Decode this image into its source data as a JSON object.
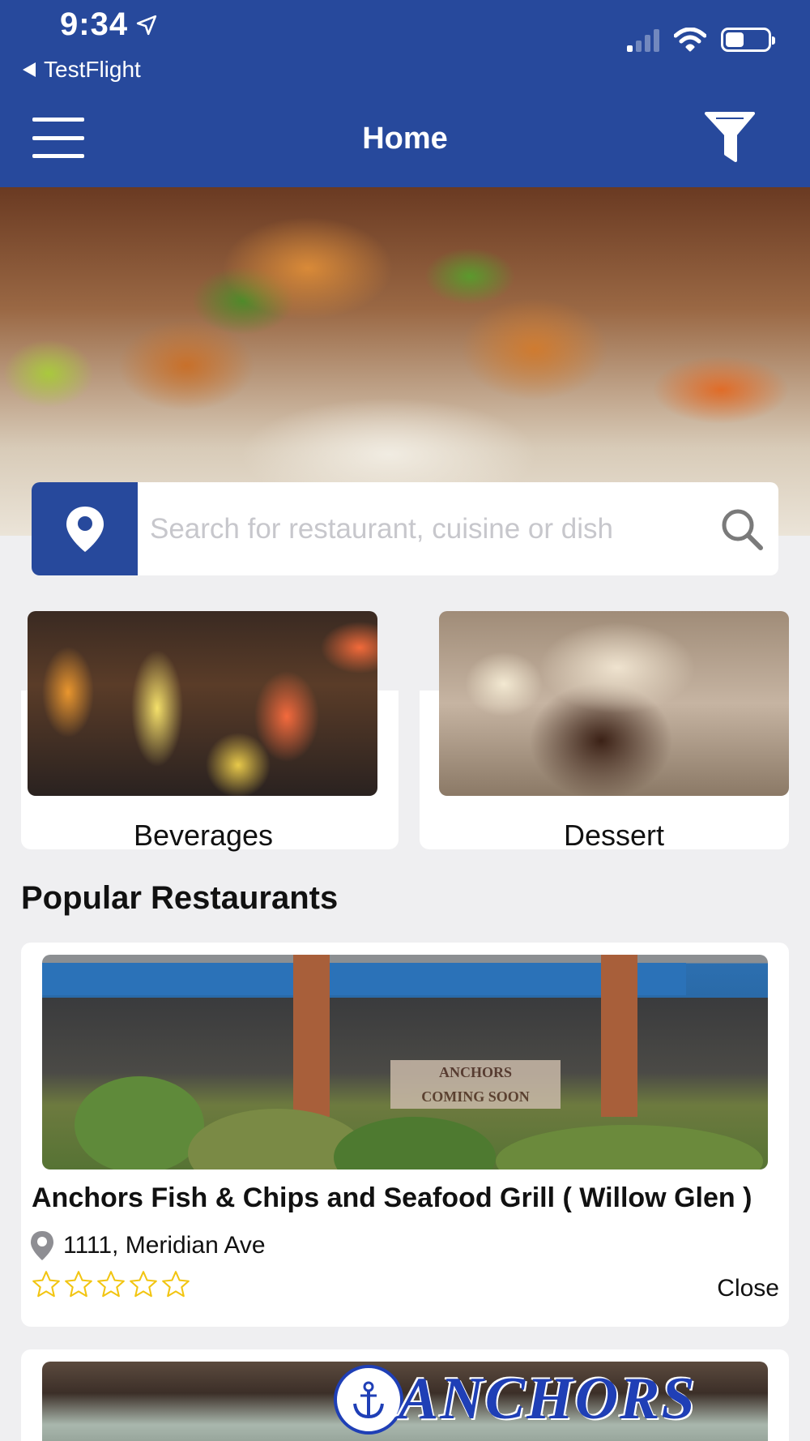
{
  "status_bar": {
    "time": "9:34",
    "back_app": "TestFlight"
  },
  "header": {
    "title": "Home",
    "background": "#27499c"
  },
  "search": {
    "placeholder": "Search for restaurant, cuisine or dish",
    "value": ""
  },
  "categories": [
    {
      "label": "Beverages"
    },
    {
      "label": "Dessert"
    }
  ],
  "popular": {
    "title": "Popular Restaurants",
    "restaurants": [
      {
        "name": "Anchors Fish & Chips and Seafood Grill ( Willow Glen )",
        "address": "1111, Meridian Ave",
        "rating": 0,
        "rating_max": 5,
        "status": "Close",
        "sign_text": "ANCHORS",
        "sign_subtext": "COMING SOON"
      },
      {
        "sign_text": "ANCHORS"
      }
    ]
  },
  "colors": {
    "primary": "#27499c",
    "star": "#f2c511",
    "background": "#efeff1"
  }
}
